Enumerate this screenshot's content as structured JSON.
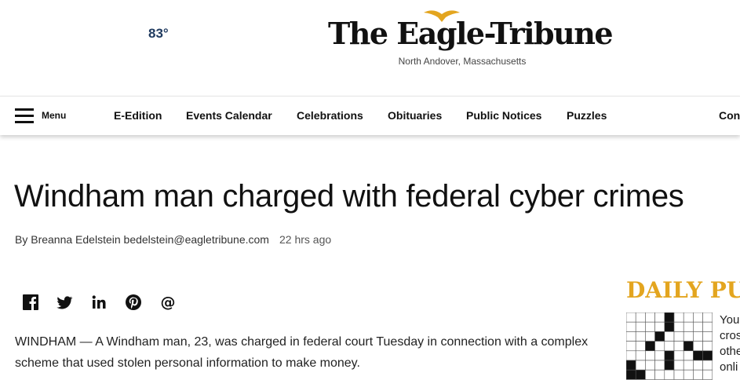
{
  "header": {
    "weather": "83°",
    "logo_text": "The Eagle-Tribune",
    "location": "North Andover, Massachusetts"
  },
  "nav": {
    "menu_label": "Menu",
    "items": [
      "E-Edition",
      "Events Calendar",
      "Celebrations",
      "Obituaries",
      "Public Notices",
      "Puzzles",
      "Con"
    ]
  },
  "article": {
    "headline": "Windham man charged with federal cyber crimes",
    "byline": "By Breanna Edelstein bedelstein@eagletribune.com",
    "timestamp": "22 hrs ago",
    "share_icons": [
      "facebook-icon",
      "twitter-icon",
      "linkedin-icon",
      "pinterest-icon",
      "email-icon"
    ],
    "body": "WINDHAM — A Windham man, 23, was charged in federal court Tuesday in connection with a complex scheme that used stolen personal information to make money."
  },
  "sidebar": {
    "puzzle_title": "DAILY PU",
    "puzzle_desc": [
      "You",
      "cros",
      "othe",
      "onli"
    ]
  },
  "colors": {
    "accent_gold": "#e3a51f",
    "weather_navy": "#1f3a5f"
  }
}
